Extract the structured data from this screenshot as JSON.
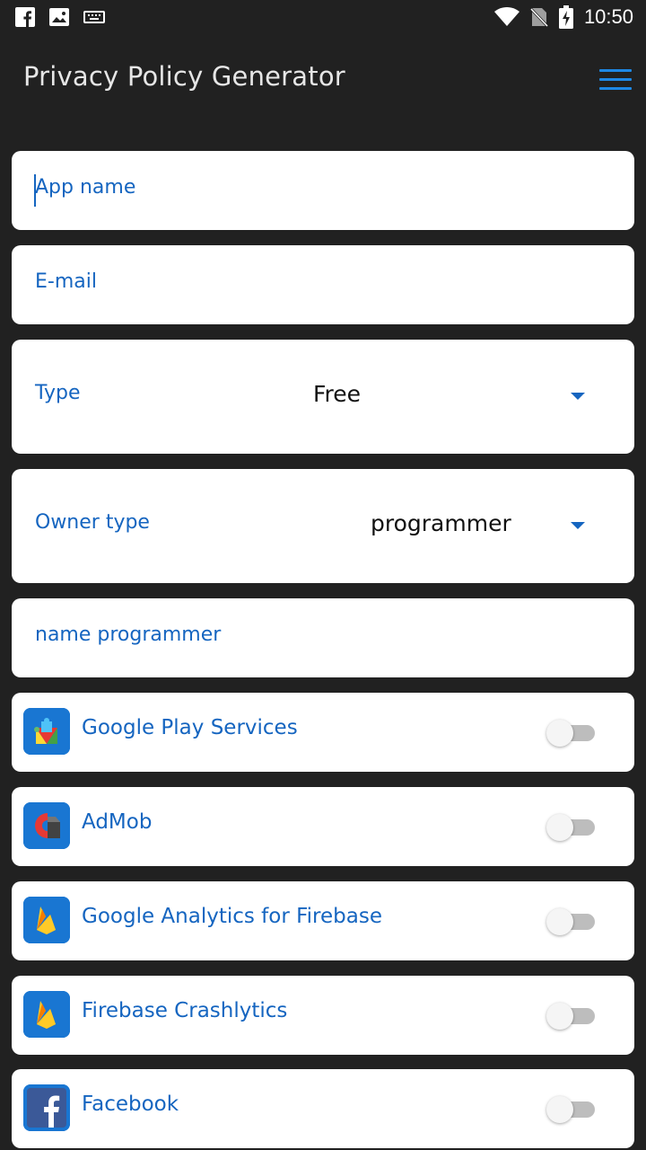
{
  "status_bar": {
    "time": "10:50",
    "left_icons": [
      "facebook-icon",
      "image-icon",
      "keyboard-icon"
    ],
    "right_icons": [
      "wifi-icon",
      "no-sim-icon",
      "battery-charging-icon"
    ]
  },
  "app_bar": {
    "title": "Privacy Policy Generator",
    "menu_icon": "hamburger-menu-icon",
    "accent_color": "#1e88e5"
  },
  "form": {
    "app_name_placeholder": "App name",
    "email_placeholder": "E-mail",
    "type_label": "Type",
    "type_value": "Free",
    "owner_type_label": "Owner type",
    "owner_type_value": "programmer",
    "name_programmer_placeholder": "name programmer"
  },
  "services": [
    {
      "label": "Google Play Services",
      "icon": "google-play-services-icon",
      "enabled": false
    },
    {
      "label": "AdMob",
      "icon": "admob-icon",
      "enabled": false
    },
    {
      "label": "Google Analytics for Firebase",
      "icon": "firebase-icon",
      "enabled": false
    },
    {
      "label": "Firebase Crashlytics",
      "icon": "firebase-icon",
      "enabled": false
    },
    {
      "label": "Facebook",
      "icon": "facebook-icon",
      "enabled": false
    }
  ],
  "colors": {
    "background": "#212121",
    "card": "#ffffff",
    "label_blue": "#1565c0",
    "icon_tile": "#1976d2"
  }
}
